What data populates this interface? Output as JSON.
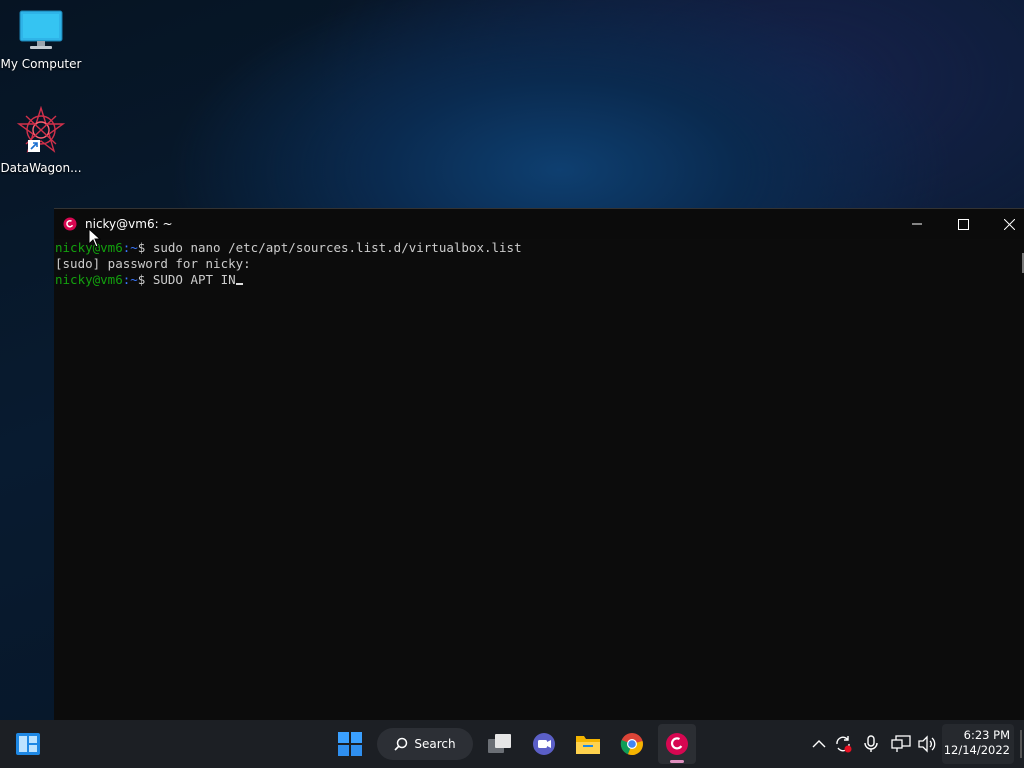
{
  "desktop": {
    "icons": [
      {
        "label": "My Computer",
        "icon": "monitor-icon"
      },
      {
        "label": "DataWagon...",
        "icon": "datawagon-icon"
      }
    ]
  },
  "terminal": {
    "title": "nicky@vm6: ~",
    "lines": [
      {
        "user": "nicky@vm6",
        "path": ":~",
        "rest": "$ sudo nano /etc/apt/sources.list.d/virtualbox.list"
      },
      {
        "text": "[sudo] password for nicky:"
      },
      {
        "user": "nicky@vm6",
        "path": ":~",
        "rest": "$ SUDO APT IN"
      }
    ]
  },
  "taskbar": {
    "search_label": "Search",
    "apps": [
      "widgets-icon",
      "start-icon",
      "task-view-icon",
      "teams-icon",
      "file-explorer-icon",
      "chrome-icon",
      "debian-terminal-icon"
    ],
    "clock": {
      "time": "6:23 PM",
      "date": "12/14/2022"
    }
  },
  "colors": {
    "prompt_user": "#13a10e",
    "prompt_path": "#3b78ff",
    "accent": "#e08fbf"
  }
}
